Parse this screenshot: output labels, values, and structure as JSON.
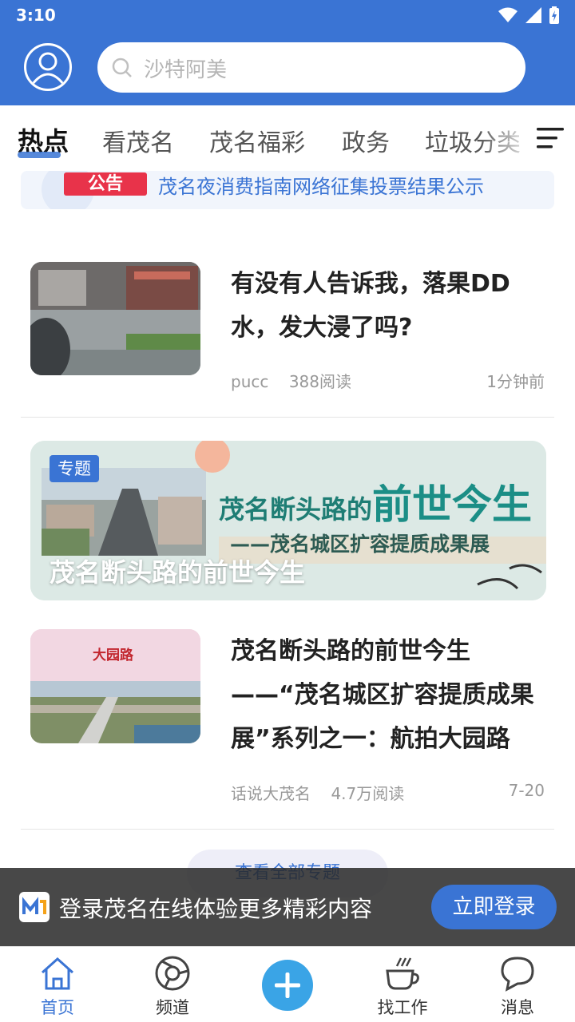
{
  "status_bar": {
    "time": "3:10"
  },
  "search": {
    "placeholder": "沙特阿美"
  },
  "tabs": [
    {
      "label": "热点",
      "active": true
    },
    {
      "label": "看茂名"
    },
    {
      "label": "茂名福彩"
    },
    {
      "label": "政务"
    },
    {
      "label": "垃圾分类"
    }
  ],
  "notice": {
    "badge": "公告",
    "text": "茂名夜消费指南网络征集投票结果公示"
  },
  "articles": [
    {
      "title": "有没有人告诉我，落果DD水，发大浸了吗?",
      "author": "pucc",
      "reads": "388阅读",
      "time": "1分钟前"
    },
    {
      "title": "茂名断头路的前世今生——“茂名城区扩容提质成果展”系列之一：航拍大园路",
      "author": "话说大茂名",
      "reads": "4.7万阅读",
      "time": "7-20",
      "thumb_overlay_text": "大园路"
    }
  ],
  "banner": {
    "tag": "专题",
    "title_prefix": "茂名断头路的",
    "title_big": "前世今生",
    "subtitle": "——茂名城区扩容提质成果展",
    "caption": "茂名断头路的前世今生"
  },
  "view_all": "查看全部专题",
  "login_bar": {
    "text": "登录茂名在线体验更多精彩内容",
    "button": "立即登录"
  },
  "bottom_nav": [
    {
      "label": "首页",
      "icon": "home-icon",
      "active": true
    },
    {
      "label": "频道",
      "icon": "channel-icon"
    },
    {
      "label": "",
      "icon": "plus-icon"
    },
    {
      "label": "找工作",
      "icon": "coffee-icon"
    },
    {
      "label": "消息",
      "icon": "message-icon"
    }
  ],
  "colors": {
    "primary": "#3a74d4",
    "notice_badge": "#e8334a",
    "plus": "#3aa4e6"
  }
}
